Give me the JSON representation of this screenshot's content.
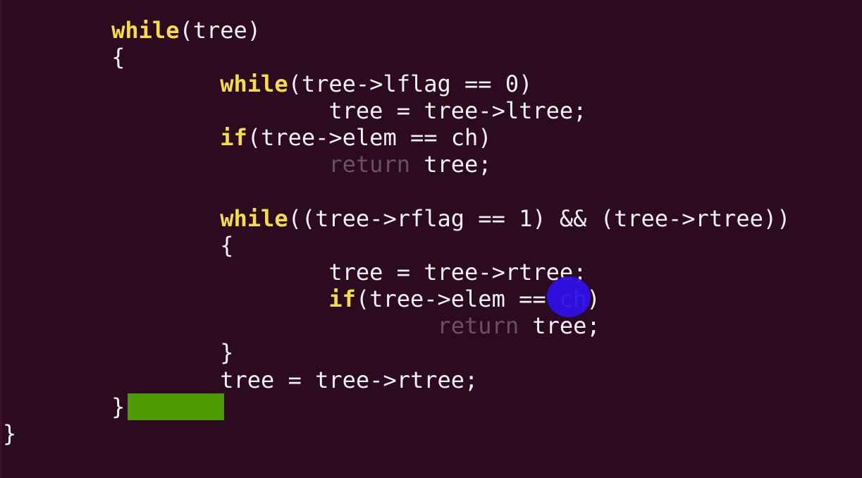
{
  "editor": {
    "lines": [
      {
        "parts": [
          {
            "t": "        "
          },
          {
            "t": "while",
            "c": "kw"
          },
          {
            "t": "(tree)"
          }
        ]
      },
      {
        "parts": [
          {
            "t": "        {"
          }
        ]
      },
      {
        "parts": [
          {
            "t": "                "
          },
          {
            "t": "while",
            "c": "kw"
          },
          {
            "t": "(tree->lflag == 0)"
          }
        ]
      },
      {
        "parts": [
          {
            "t": "                        tree = tree->ltree;"
          }
        ]
      },
      {
        "parts": [
          {
            "t": "                "
          },
          {
            "t": "if",
            "c": "kw"
          },
          {
            "t": "(tree->elem == ch)"
          }
        ]
      },
      {
        "parts": [
          {
            "t": "                        "
          },
          {
            "t": "return",
            "c": "dim"
          },
          {
            "t": " tree;"
          }
        ]
      },
      {
        "parts": [
          {
            "t": ""
          }
        ]
      },
      {
        "parts": [
          {
            "t": "                "
          },
          {
            "t": "while",
            "c": "kw"
          },
          {
            "t": "((tree->rflag == 1) && (tree->rtree))"
          }
        ]
      },
      {
        "parts": [
          {
            "t": "                {"
          }
        ]
      },
      {
        "parts": [
          {
            "t": "                        tree = tree->rtree;"
          }
        ]
      },
      {
        "parts": [
          {
            "t": "                        "
          },
          {
            "t": "if",
            "c": "kw"
          },
          {
            "t": "(tree->elem == ch)"
          }
        ]
      },
      {
        "parts": [
          {
            "t": "                                "
          },
          {
            "t": "return",
            "c": "dim"
          },
          {
            "t": " tree;"
          }
        ]
      },
      {
        "parts": [
          {
            "t": "                }"
          }
        ]
      },
      {
        "parts": [
          {
            "t": "                tree = tree->rtree;"
          }
        ]
      },
      {
        "parts": [
          {
            "t": "        }"
          }
        ]
      },
      {
        "parts": [
          {
            "t": "}"
          }
        ]
      }
    ]
  },
  "colors": {
    "background": "#2c0a20",
    "keyword": "#f7dd45",
    "text": "#f2f2f2",
    "dim_keyword": "#6b4f66",
    "cursor": "#4c9a00",
    "pointer": "#2f10e6"
  }
}
